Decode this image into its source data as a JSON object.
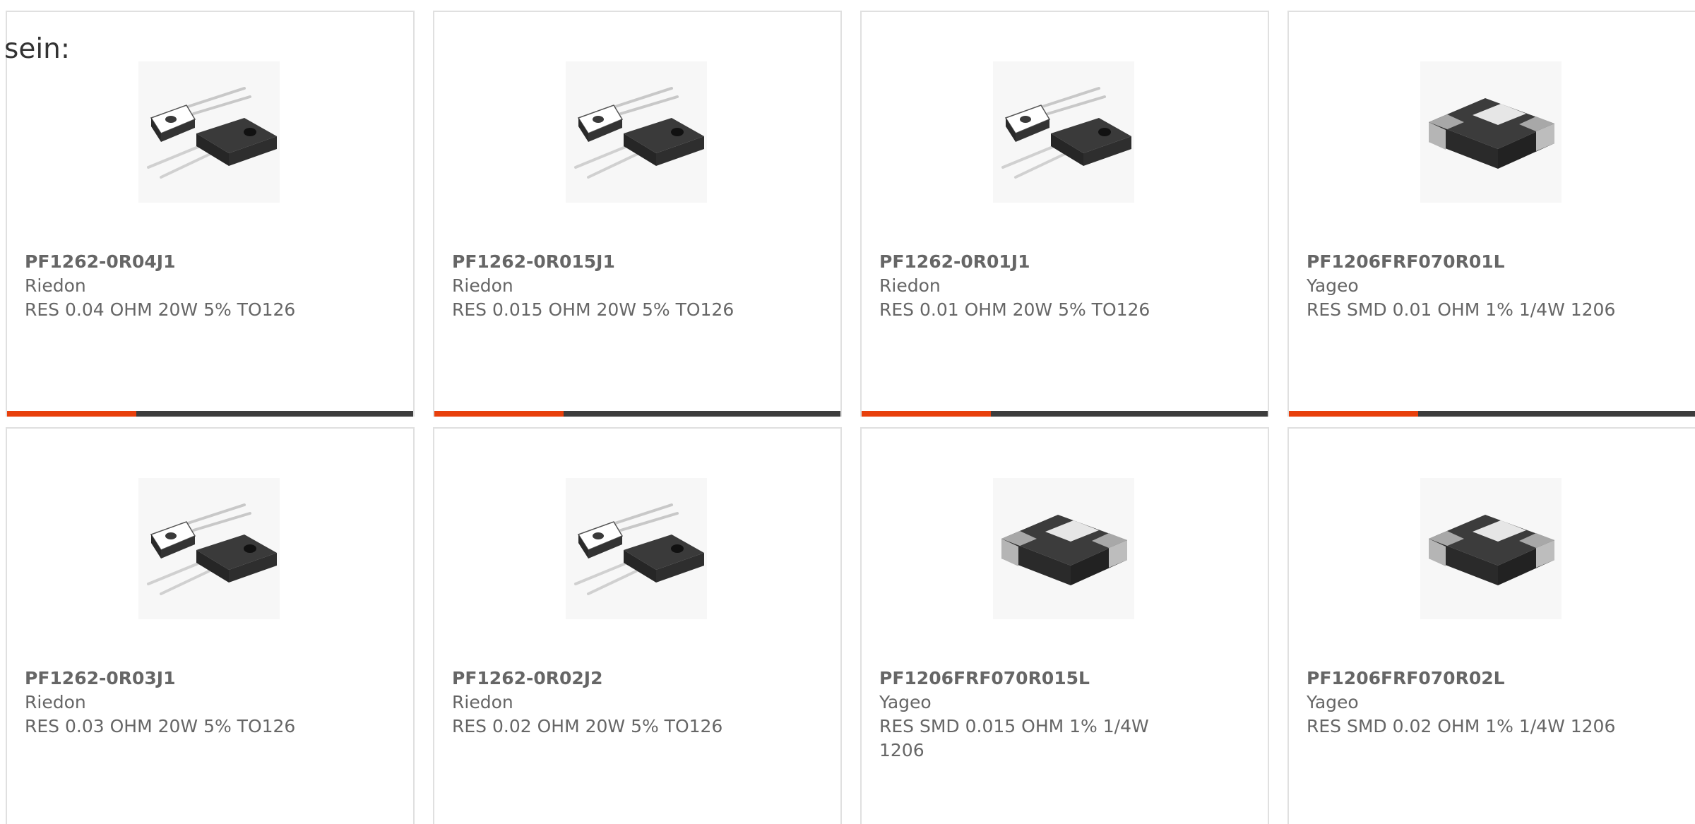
{
  "intro_text": "sein:",
  "colors": {
    "accent": "#e8400c",
    "bar_dark": "#3d3d3d",
    "border": "#e0e0e0",
    "text": "#666666"
  },
  "products": [
    {
      "part_number": "PF1262-0R04J1",
      "manufacturer": "Riedon",
      "description": "RES 0.04 OHM 20W 5% TO126",
      "image": "to126-resistor-image"
    },
    {
      "part_number": "PF1262-0R015J1",
      "manufacturer": "Riedon",
      "description": "RES 0.015 OHM 20W 5% TO126",
      "image": "to126-resistor-image"
    },
    {
      "part_number": "PF1262-0R01J1",
      "manufacturer": "Riedon",
      "description": "RES 0.01 OHM 20W 5% TO126",
      "image": "to126-resistor-image"
    },
    {
      "part_number": "PF1206FRF070R01L",
      "manufacturer": "Yageo",
      "description": "RES SMD 0.01 OHM 1% 1/4W 1206",
      "image": "smd-chip-resistor-image"
    },
    {
      "part_number": "PF1262-0R03J1",
      "manufacturer": "Riedon",
      "description": "RES 0.03 OHM 20W 5% TO126",
      "image": "to126-resistor-image"
    },
    {
      "part_number": "PF1262-0R02J2",
      "manufacturer": "Riedon",
      "description": "RES 0.02 OHM 20W 5% TO126",
      "image": "to126-resistor-image"
    },
    {
      "part_number": "PF1206FRF070R015L",
      "manufacturer": "Yageo",
      "description": "RES SMD 0.015 OHM 1% 1/4W 1206",
      "image": "smd-chip-resistor-image"
    },
    {
      "part_number": "PF1206FRF070R02L",
      "manufacturer": "Yageo",
      "description": "RES SMD 0.02 OHM 1% 1/4W 1206",
      "image": "smd-chip-resistor-image"
    }
  ]
}
